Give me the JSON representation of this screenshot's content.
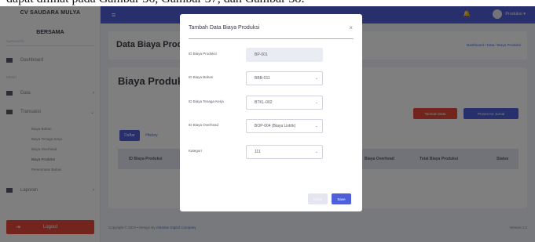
{
  "top_text": "dapat dilihat pada Gambar 36, Gambar 37, dan Gambar 38:",
  "sidebar": {
    "brand_line1": "CV SAUDARA MULYA",
    "brand_line2": "BERSAMA",
    "brand_sub": "SUPPLIERS",
    "dashboard": "Dashboard",
    "section_master": "MENU",
    "data": "Data",
    "transaksi": "Transaksi",
    "sub_items": [
      "Biaya Bahan",
      "Biaya Tenaga Kerja",
      "Biaya Overhead",
      "Biaya Produksi",
      "Penerimaan Bahan"
    ],
    "laporan": "Laporan",
    "logout": "Logout"
  },
  "topbar": {
    "user_label": "Produksi ▾"
  },
  "page": {
    "title": "Data Biaya Produksi",
    "breadcrumb": "Dashboard / Data / Biaya Produksi",
    "heading": "Biaya Produksi",
    "btn_tambah": "Tambah Data",
    "btn_proses": "Proses Ke Jurnal",
    "tab_daftar": "Daftar",
    "tab_history": "History",
    "columns": [
      "ID Biaya Produksi",
      "Biaya Overhead",
      "Total Biaya Produksi",
      "Status"
    ]
  },
  "footer": {
    "copyright": "Copyright © 2022 • Design By",
    "author": "Akuntan Digital Company",
    "version": "Version 1.0"
  },
  "modal": {
    "title": "Tambah Data Biaya Produksi",
    "fields": [
      {
        "label": "ID Biaya Produksi",
        "value": "BP-001"
      },
      {
        "label": "ID Biaya Bahan",
        "value": "BBB-011"
      },
      {
        "label": "ID Biaya Tenaga Kerja",
        "value": "BTKL-002"
      },
      {
        "label": "ID Biaya Overhead",
        "value": "BOP-004 (Biaya Listrik)"
      },
      {
        "label": "Kategori",
        "value": "111"
      }
    ],
    "close_label": "Close",
    "save_label": "Save"
  }
}
